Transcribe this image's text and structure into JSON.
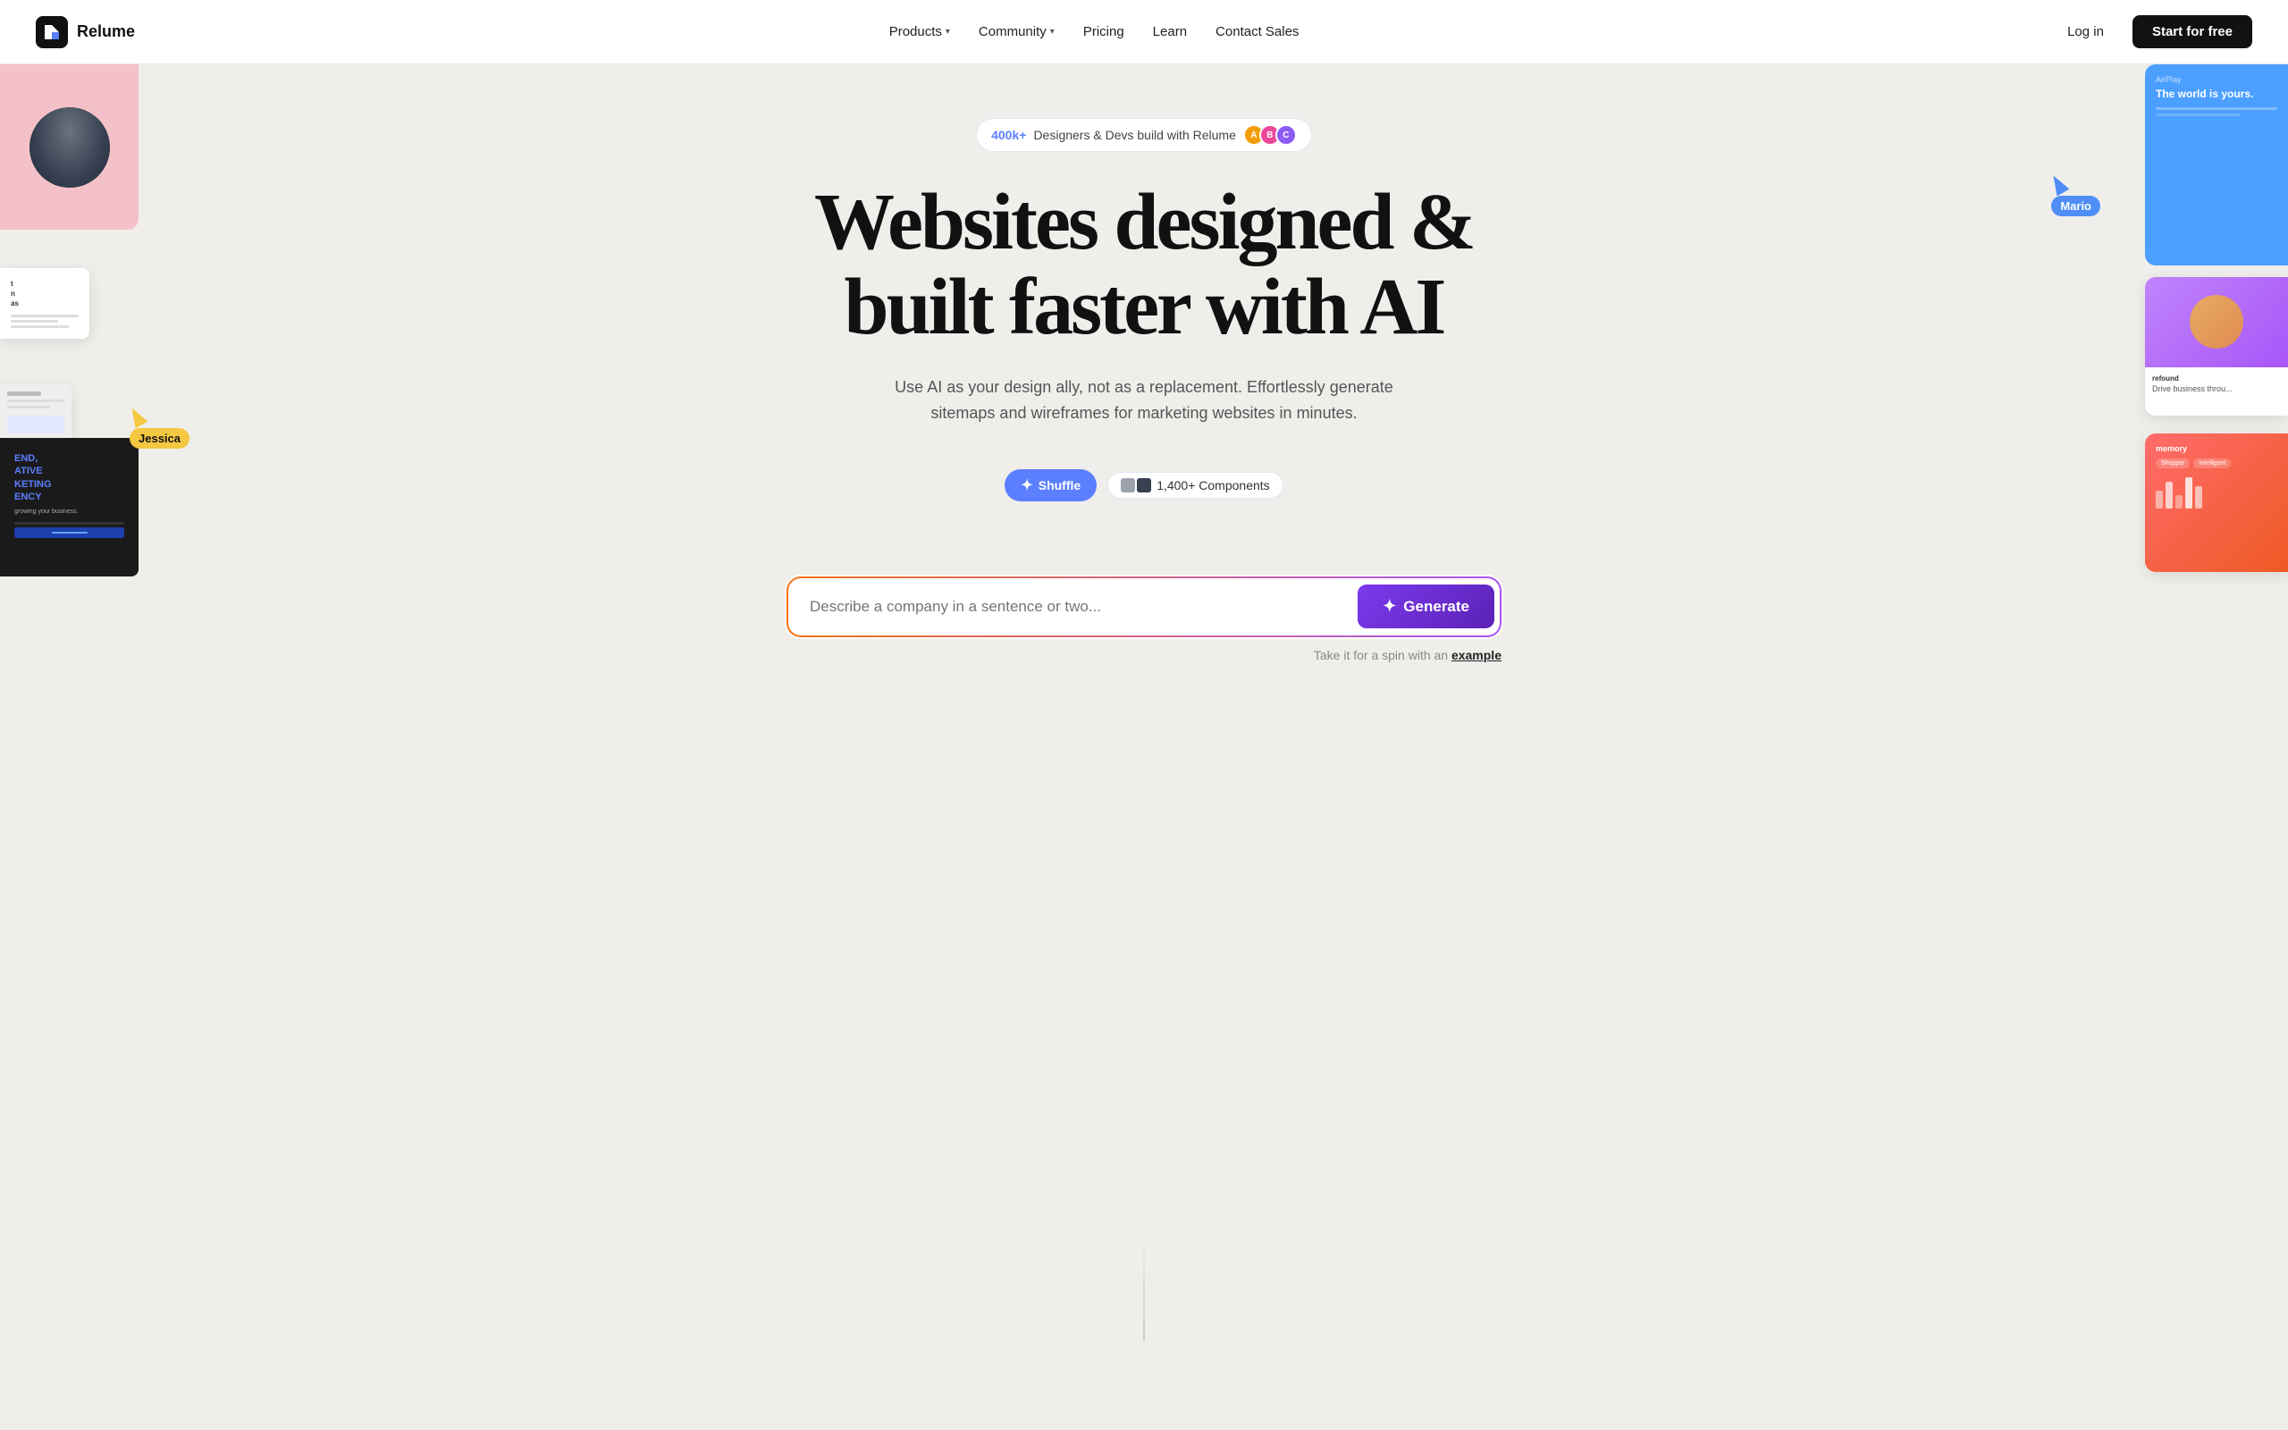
{
  "nav": {
    "logo_text": "Relume",
    "items": [
      {
        "label": "Products",
        "has_dropdown": true
      },
      {
        "label": "Community",
        "has_dropdown": true
      },
      {
        "label": "Pricing",
        "has_dropdown": false
      },
      {
        "label": "Learn",
        "has_dropdown": false
      },
      {
        "label": "Contact Sales",
        "has_dropdown": false
      }
    ],
    "login_label": "Log in",
    "start_label": "Start for free"
  },
  "hero": {
    "social_proof_count": "400k+",
    "social_proof_text": "Designers & Devs build with Relume",
    "title_line1": "Websites designed &",
    "title_line2": "built faster with AI",
    "subtitle": "Use AI as your design ally, not as a replacement. Effortlessly generate sitemaps and wireframes for marketing websites in minutes."
  },
  "shuffle_bar": {
    "shuffle_label": "Shuffle",
    "components_label": "1,400+ Components"
  },
  "generate": {
    "placeholder": "Describe a company in a sentence or two...",
    "button_label": "Generate",
    "hint_text": "Take it for a spin with an",
    "example_label": "example"
  },
  "cursors": {
    "jessica_label": "Jessica",
    "mario_label": "Mario"
  },
  "floating": {
    "right_top_text": "The world is yours.",
    "left_dark_text": "END, ATIVE KETING ENCY"
  }
}
